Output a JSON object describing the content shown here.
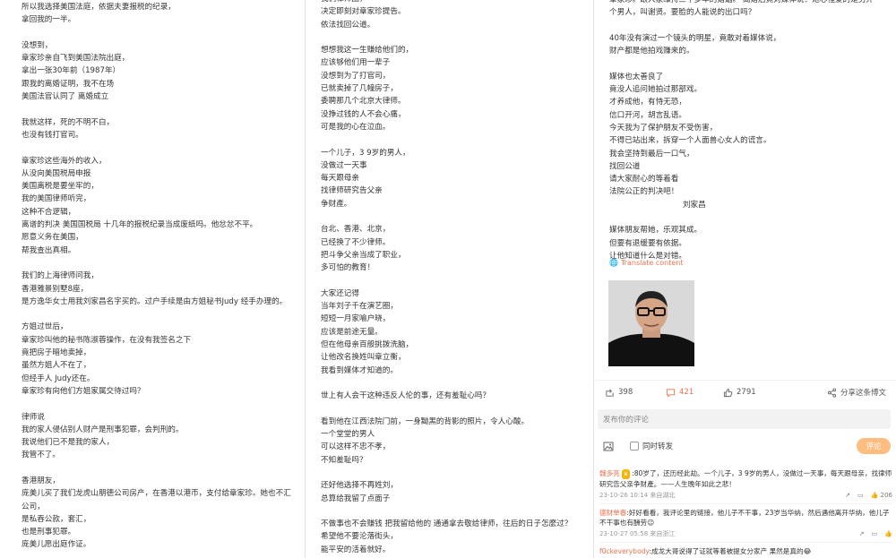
{
  "col1": {
    "lines": [
      "所以我选择美国法庭，依据夫妻报税的纪录，",
      "拿回我的一半。",
      "",
      "没想到，",
      "章家珍亲自飞到美国法院出庭，",
      "拿出一张30年前（1987年）",
      "跟我的离婚证明，我不在场",
      "美国法官认同了 离婚成立",
      "",
      "我就这样，死的不明不白，",
      "也没有钱打官司。",
      "",
      "章家珍这些海外的收入，",
      "从没向美国税局申报",
      "美国离税是要坐牢的，",
      "我的美国律师听完，",
      "这种不合逻辑，",
      "离谱的判决 美国国税局 十几年的报税纪录当成废纸吗。他忿忿不平。",
      "愿意义务在美国，",
      "帮我查出真相。",
      "",
      "我们的上海律师问我，",
      "香港雅景别墅8座，",
      "是方逸华女士用我刘家昌名字买的。过户手续是由方姐秘书Judy 经手办理的。",
      "",
      "方姐过世后，",
      "章家珍叫他的秘书陈淑蓉操作，在没有我签名之下",
      "竟把房子暗地卖掉，",
      "虽然方姐人不在了，",
      "但经手人 Judy还在。",
      "章家珍有向他们方姐家属交待过吗？",
      "",
      "律师说",
      "我的家人侵佔别人财产是刑事犯罪，会判刑的。",
      "我说他们已不是我的家人，",
      "我管不了。",
      "",
      "香港朋友，",
      "庞美儿买了我们龙虎山朋德公司房产，在香港以港币，支付给章家珍。她也不汇",
      "公司，",
      "是私吞公款，套汇，",
      "也是刑事犯罪。",
      "庞美儿愿出庭作证。"
    ]
  },
  "col2": {
    "lines": [
      "我们律师团，",
      "决定即刻对章家珍提告。",
      "依法找回公道。",
      "",
      "想想我这一生赚给他们的，",
      "应该够他们用一辈子",
      "没想到为了打官司，",
      "已就卖掉了几幢房子，",
      "委聘那几个北京大律师。",
      "没挣过钱的人不会心痛，",
      "可是我的心在泣血。",
      "",
      "一个儿子，3 9岁的男人，",
      "没做过一天事",
      "每天跟母亲",
      "找律师研究告父亲",
      "争财產。",
      "",
      "台北、香港、北京，",
      "已经换了不少律师。",
      "把斗争父亲当成了职业，",
      "多可怕的教育！",
      "",
      "大家还记得",
      "当年刘子千在演艺圈，",
      "短短一月家喻户晓，",
      "应该是前途无量。",
      "但在他母亲百般挑拨洗脑，",
      "让他改名换姓叫章立衡，",
      "我看到媒体才知道的。",
      "",
      "世上有人会干这种违反人伦的事，还有羞耻心吗？",
      "",
      "看到他在江西法院门前，一身黝黑的背影的照片，令人心酸。",
      "一个堂堂的男人",
      "可以这样不忠不孝，",
      "不知羞耻吗？",
      "",
      "还好他选择不再姓刘，",
      "总算给我留了点面子",
      "",
      "不做事也不会赚钱 把我留给他的 通通拿去敬给律师，往后的日子怎麼过？",
      "希望他不要沦落街头，",
      "能平安的活着就好。"
    ]
  },
  "col3": {
    "lines": [
      "章家珍。跟人家维持三十多年的婚姻。 离婚后竟对媒体说：她心裡爱的是另外一",
      "个男人，叫谢贤。要脸的人能说的出口吗？",
      "",
      "40年没有演过一个镜头的明星，竟敢对着媒体说，",
      "财产都是他拍戏赚来的。",
      "",
      "媒体也太善良了",
      "竟没人追问她拍过那部戏。",
      "才养成他，有恃无恐，",
      "信口开河，胡言乱语。",
      "今天我为了保护朋友不受伤害，",
      "不得已站出来，拆穿一个人面兽心女人的谎言。",
      "我会坚持到最后一口气，",
      "找回公道",
      "请大家耐心的等着看",
      "法院公正的判决吧！",
      "                              刘家昌",
      "",
      "媒体朋友帮她，乐观其成。",
      "但要有退缓要有依据。",
      "让他知道什么是对错。"
    ],
    "translate_label": "Translate content",
    "actions": {
      "share_count": "398",
      "comment_count": "421",
      "like_count": "2791",
      "share_to_weibo": "分享这条博文"
    },
    "comment_input_placeholder": "发布你的评论",
    "forward_checkbox_label": "同时转发",
    "submit_label": "评论",
    "comments": [
      {
        "user": "魏多亮",
        "badge": "♛",
        "text": ":80岁了，还历经此劫。一个儿子，3 9岁的男人，没做过一天事，每天跟母亲，找律师研究告父亲争财產。——人生晚年如此之悲！",
        "meta": "23-10-26 10:14 来自湖北",
        "likes": "206"
      },
      {
        "user": "德财单春",
        "text": ":好好看看，我评论里的链接，他儿子不干事，23岁当华纳，然后遇他离开华纳，他儿子不干事也有酬劳😉",
        "meta": "23-10-27 05:58 来自浙江"
      },
      {
        "user": "f0ckeverybody",
        "text": ":成龙大哥说得了证就等着被提女分家产 果然是真的😂"
      }
    ]
  },
  "colors": {
    "accent": "#eb7350",
    "text": "#333333",
    "submit_button": "#ffbd7f",
    "comment_icon": "#eb7350"
  }
}
